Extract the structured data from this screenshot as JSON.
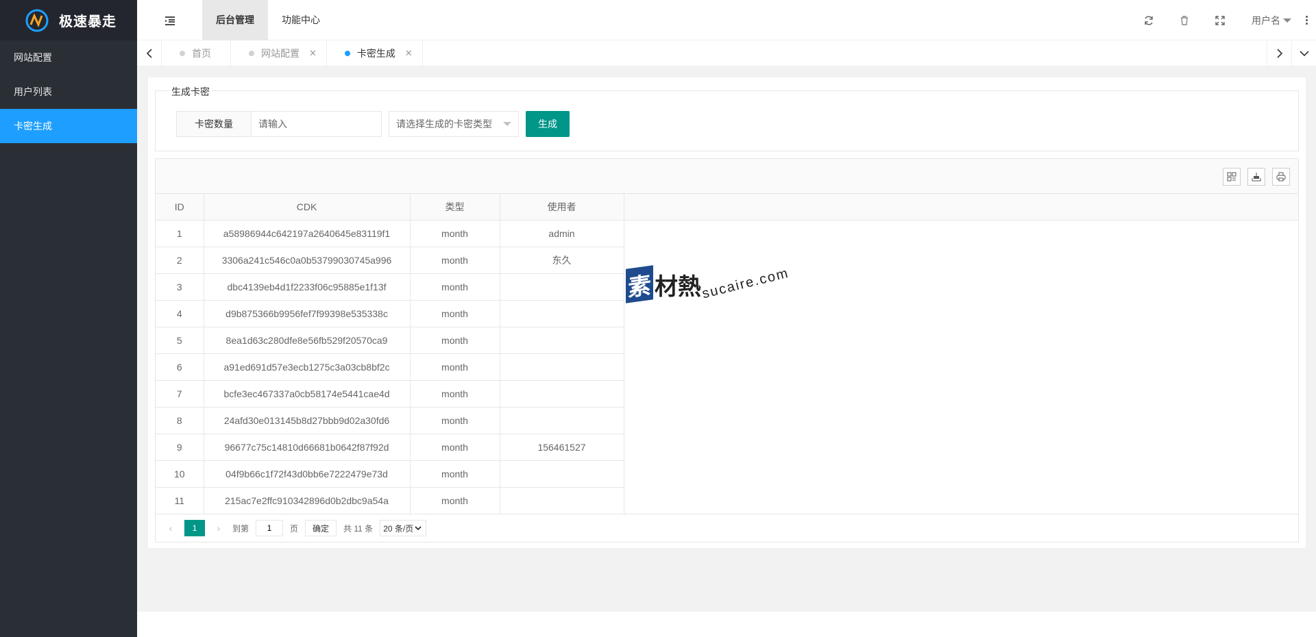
{
  "app": {
    "name": "极速暴走"
  },
  "sidebar": {
    "items": [
      {
        "label": "网站配置"
      },
      {
        "label": "用户列表"
      },
      {
        "label": "卡密生成"
      }
    ]
  },
  "header": {
    "tabs": [
      {
        "label": "后台管理"
      },
      {
        "label": "功能中心"
      }
    ],
    "user": "用户名"
  },
  "pagetabs": [
    {
      "label": "首页"
    },
    {
      "label": "网站配置"
    },
    {
      "label": "卡密生成"
    }
  ],
  "form": {
    "legend": "生成卡密",
    "qty_label": "卡密数量",
    "qty_placeholder": "请输入",
    "type_placeholder": "请选择生成的卡密类型",
    "submit_label": "生成"
  },
  "table": {
    "columns": [
      "ID",
      "CDK",
      "类型",
      "使用者"
    ],
    "rows": [
      [
        "1",
        "a58986944c642197a2640645e83119f1",
        "month",
        "admin"
      ],
      [
        "2",
        "3306a241c546c0a0b53799030745a996",
        "month",
        "东久"
      ],
      [
        "3",
        "dbc4139eb4d1f2233f06c95885e1f13f",
        "month",
        ""
      ],
      [
        "4",
        "d9b875366b9956fef7f99398e535338c",
        "month",
        ""
      ],
      [
        "5",
        "8ea1d63c280dfe8e56fb529f20570ca9",
        "month",
        ""
      ],
      [
        "6",
        "a91ed691d57e3ecb1275c3a03cb8bf2c",
        "month",
        ""
      ],
      [
        "7",
        "bcfe3ec467337a0cb58174e5441cae4d",
        "month",
        ""
      ],
      [
        "8",
        "24afd30e013145b8d27bbb9d02a30fd6",
        "month",
        ""
      ],
      [
        "9",
        "96677c75c14810d66681b0642f87f92d",
        "month",
        "156461527"
      ],
      [
        "10",
        "04f9b66c1f72f43d0bb6e7222479e73d",
        "month",
        ""
      ],
      [
        "11",
        "215ac7e2ffc910342896d0b2dbc9a54a",
        "month",
        ""
      ]
    ]
  },
  "pager": {
    "current": "1",
    "goto_label": "到第",
    "page_input": "1",
    "page_unit": "页",
    "confirm": "确定",
    "total": "共 11 条",
    "page_size": "20 条/页"
  },
  "watermark": {
    "box": "素",
    "cn": "材熱",
    "en": "sucaire.com"
  },
  "colors": {
    "sidebar": "#2a2f36",
    "active": "#1e9fff",
    "primary": "#009688"
  }
}
